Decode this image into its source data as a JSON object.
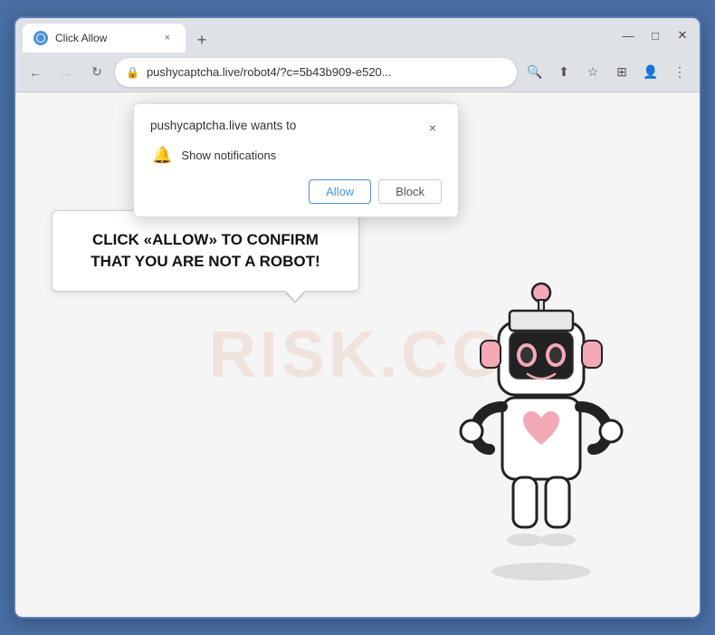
{
  "browser": {
    "tab_title": "Click Allow",
    "tab_close": "×",
    "new_tab": "+",
    "window_minimize": "—",
    "window_maximize": "□",
    "window_close": "✕",
    "nav_back": "←",
    "nav_forward": "→",
    "nav_refresh": "↻",
    "address_url": "pushycaptcha.live/robot4/?c=5b43b909-e520...",
    "address_lock": "🔒",
    "nav_search_icon": "🔍",
    "nav_share_icon": "⬆",
    "nav_star_icon": "☆",
    "nav_extensions_icon": "⊞",
    "nav_profile_icon": "👤",
    "nav_menu_icon": "⋮"
  },
  "notification_popup": {
    "title": "pushycaptcha.live wants to",
    "close_btn": "×",
    "notification_icon": "🔔",
    "notification_text": "Show notifications",
    "allow_label": "Allow",
    "block_label": "Block"
  },
  "page_content": {
    "speech_text": "CLICK «ALLOW» TO CONFIRM THAT YOU ARE NOT A ROBOT!",
    "watermark": "RISK.CO"
  }
}
